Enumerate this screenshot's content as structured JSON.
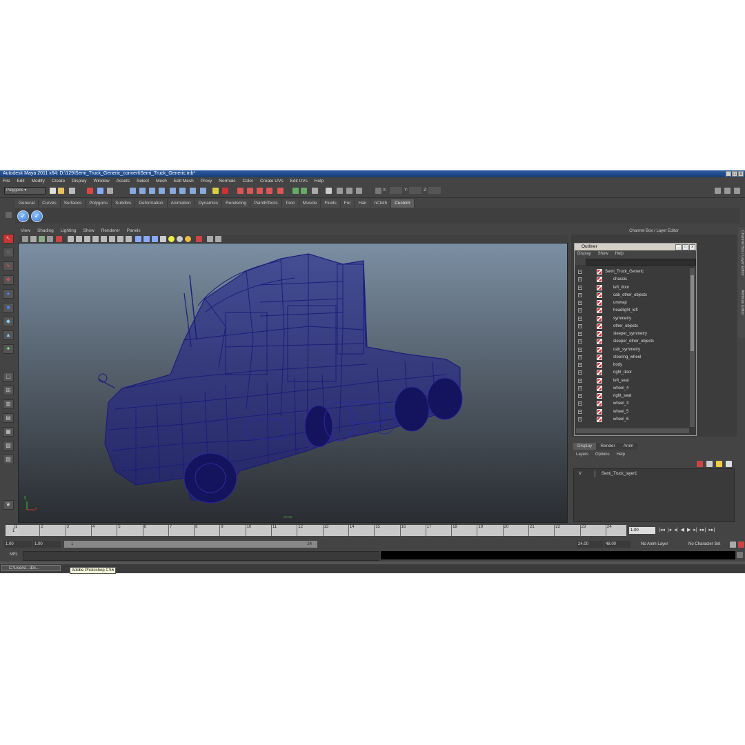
{
  "window": {
    "title": "Autodesk Maya 2011 x64: D:\\129\\Semi_Truck_Generic_convert\\Semi_Truck_Generic.mb*",
    "controls": [
      "_",
      "□",
      "X"
    ]
  },
  "menubar": [
    "File",
    "Edit",
    "Modify",
    "Create",
    "Display",
    "Window",
    "Assets",
    "Select",
    "Mesh",
    "Edit Mesh",
    "Proxy",
    "Normals",
    "Color",
    "Create UVs",
    "Edit UVs",
    "Help"
  ],
  "statusline": {
    "mode": "Polygons",
    "coord_labels": [
      "X:",
      "Y:",
      "Z:"
    ]
  },
  "shelf": {
    "tabs": [
      "General",
      "Curves",
      "Surfaces",
      "Polygons",
      "Subdivs",
      "Deformation",
      "Animation",
      "Dynamics",
      "Rendering",
      "PaintEffects",
      "Toon",
      "Muscle",
      "Fluids",
      "Fur",
      "Hair",
      "nCloth",
      "Custom"
    ],
    "active_tab": "Custom"
  },
  "panel": {
    "menu": [
      "View",
      "Shading",
      "Lighting",
      "Show",
      "Renderer",
      "Panels"
    ],
    "camera": "persp"
  },
  "viewport": {
    "axis_x": "x",
    "axis_y": "y",
    "wire_color": "#1a1a7a"
  },
  "channel_box": {
    "title": "Channel Box / Layer Editor",
    "side_tabs": [
      "Channel Box / Layer Editor",
      "Attribute Editor"
    ]
  },
  "outliner": {
    "title": "Outliner",
    "menu": [
      "Display",
      "Show",
      "Help"
    ],
    "root": "Semi_Truck_Generic",
    "items": [
      "chassis",
      "left_door",
      "cab_other_objects",
      "unwrap",
      "headlight_left",
      "symmetry",
      "other_objects",
      "sleeper_symmetry",
      "sleeper_other_objects",
      "cab_symmetry",
      "steering_wheel",
      "body",
      "right_door",
      "left_seat",
      "wheel_4",
      "right_seat",
      "wheel_3",
      "wheel_5",
      "wheel_6"
    ]
  },
  "layers": {
    "tabs": [
      "Display",
      "Render",
      "Anim"
    ],
    "active_tab": "Display",
    "menu": [
      "Layers",
      "Options",
      "Help"
    ],
    "rows": [
      {
        "visible": "V",
        "name": "Semi_Truck_layer1"
      }
    ]
  },
  "timeline": {
    "ticks": [
      "1",
      "2",
      "3",
      "4",
      "5",
      "6",
      "7",
      "8",
      "9",
      "10",
      "11",
      "12",
      "13",
      "14",
      "15",
      "16",
      "17",
      "18",
      "19",
      "20",
      "21",
      "22",
      "23",
      "24"
    ],
    "current": "1.00",
    "current_marker": "1"
  },
  "range": {
    "start": "1.00",
    "start2": "1.00",
    "slider_start": "1",
    "slider_end": "24",
    "end": "24.00",
    "end2": "48.00",
    "anim_layer": "No Anim Layer",
    "char_set": "No Character Set"
  },
  "cmdline": {
    "label": "MEL"
  },
  "taskbar": {
    "item": "C:\\Users\\...\\Dc...",
    "tooltip": "Adobe Photoshop CS6"
  }
}
